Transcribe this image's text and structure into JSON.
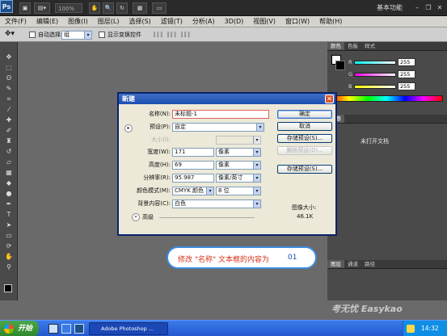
{
  "app": {
    "logo": "Ps",
    "zoom": "100%",
    "workspace": "基本功能"
  },
  "menubar": [
    "文件(F)",
    "编辑(E)",
    "图像(I)",
    "图层(L)",
    "选择(S)",
    "滤镜(T)",
    "分析(A)",
    "3D(D)",
    "视图(V)",
    "窗口(W)",
    "帮助(H)"
  ],
  "options": {
    "auto_select_label": "自动选择:",
    "auto_select_value": "组",
    "show_transform_label": "显示变换控件"
  },
  "color_panel": {
    "tabs": [
      "颜色",
      "色板",
      "样式"
    ],
    "r_label": "R",
    "g_label": "G",
    "b_label": "B",
    "r_value": "255",
    "g_value": "255",
    "b_value": "255"
  },
  "adjust_panel": {
    "tab": "调整",
    "message": "未打开文档"
  },
  "layers_panel": {
    "tabs": [
      "图层",
      "通道",
      "路径"
    ]
  },
  "dialog": {
    "title": "新建",
    "name_label": "名称(N):",
    "name_value": "未标题-1",
    "preset_label": "预设(P):",
    "preset_value": "自定",
    "size_label": "大小(I):",
    "width_label": "宽度(W):",
    "width_value": "171",
    "width_unit": "像素",
    "height_label": "高度(H):",
    "height_value": "69",
    "height_unit": "像素",
    "resolution_label": "分辨率(R):",
    "resolution_value": "95.987",
    "resolution_unit": "像素/英寸",
    "color_mode_label": "颜色模式(M):",
    "color_mode_value": "CMYK 颜色",
    "bit_depth_value": "8 位",
    "background_label": "背景内容(C):",
    "background_value": "白色",
    "advanced_label": "高级",
    "ok_button": "确定",
    "cancel_button": "取消",
    "save_preset_button": "存储预设(S)...",
    "delete_preset_button": "删除预设(D)...",
    "device_central_button": "存储预设(S)...",
    "image_size_label": "图像大小:",
    "image_size_value": "46.1K"
  },
  "callout": {
    "text": "修改 \"名称\" 文本框的内容为",
    "number": "01"
  },
  "taskbar": {
    "start": "开始",
    "task": "Adobe Photoshop ...",
    "clock": "14:32"
  },
  "watermark": "考无忧 Easykao"
}
